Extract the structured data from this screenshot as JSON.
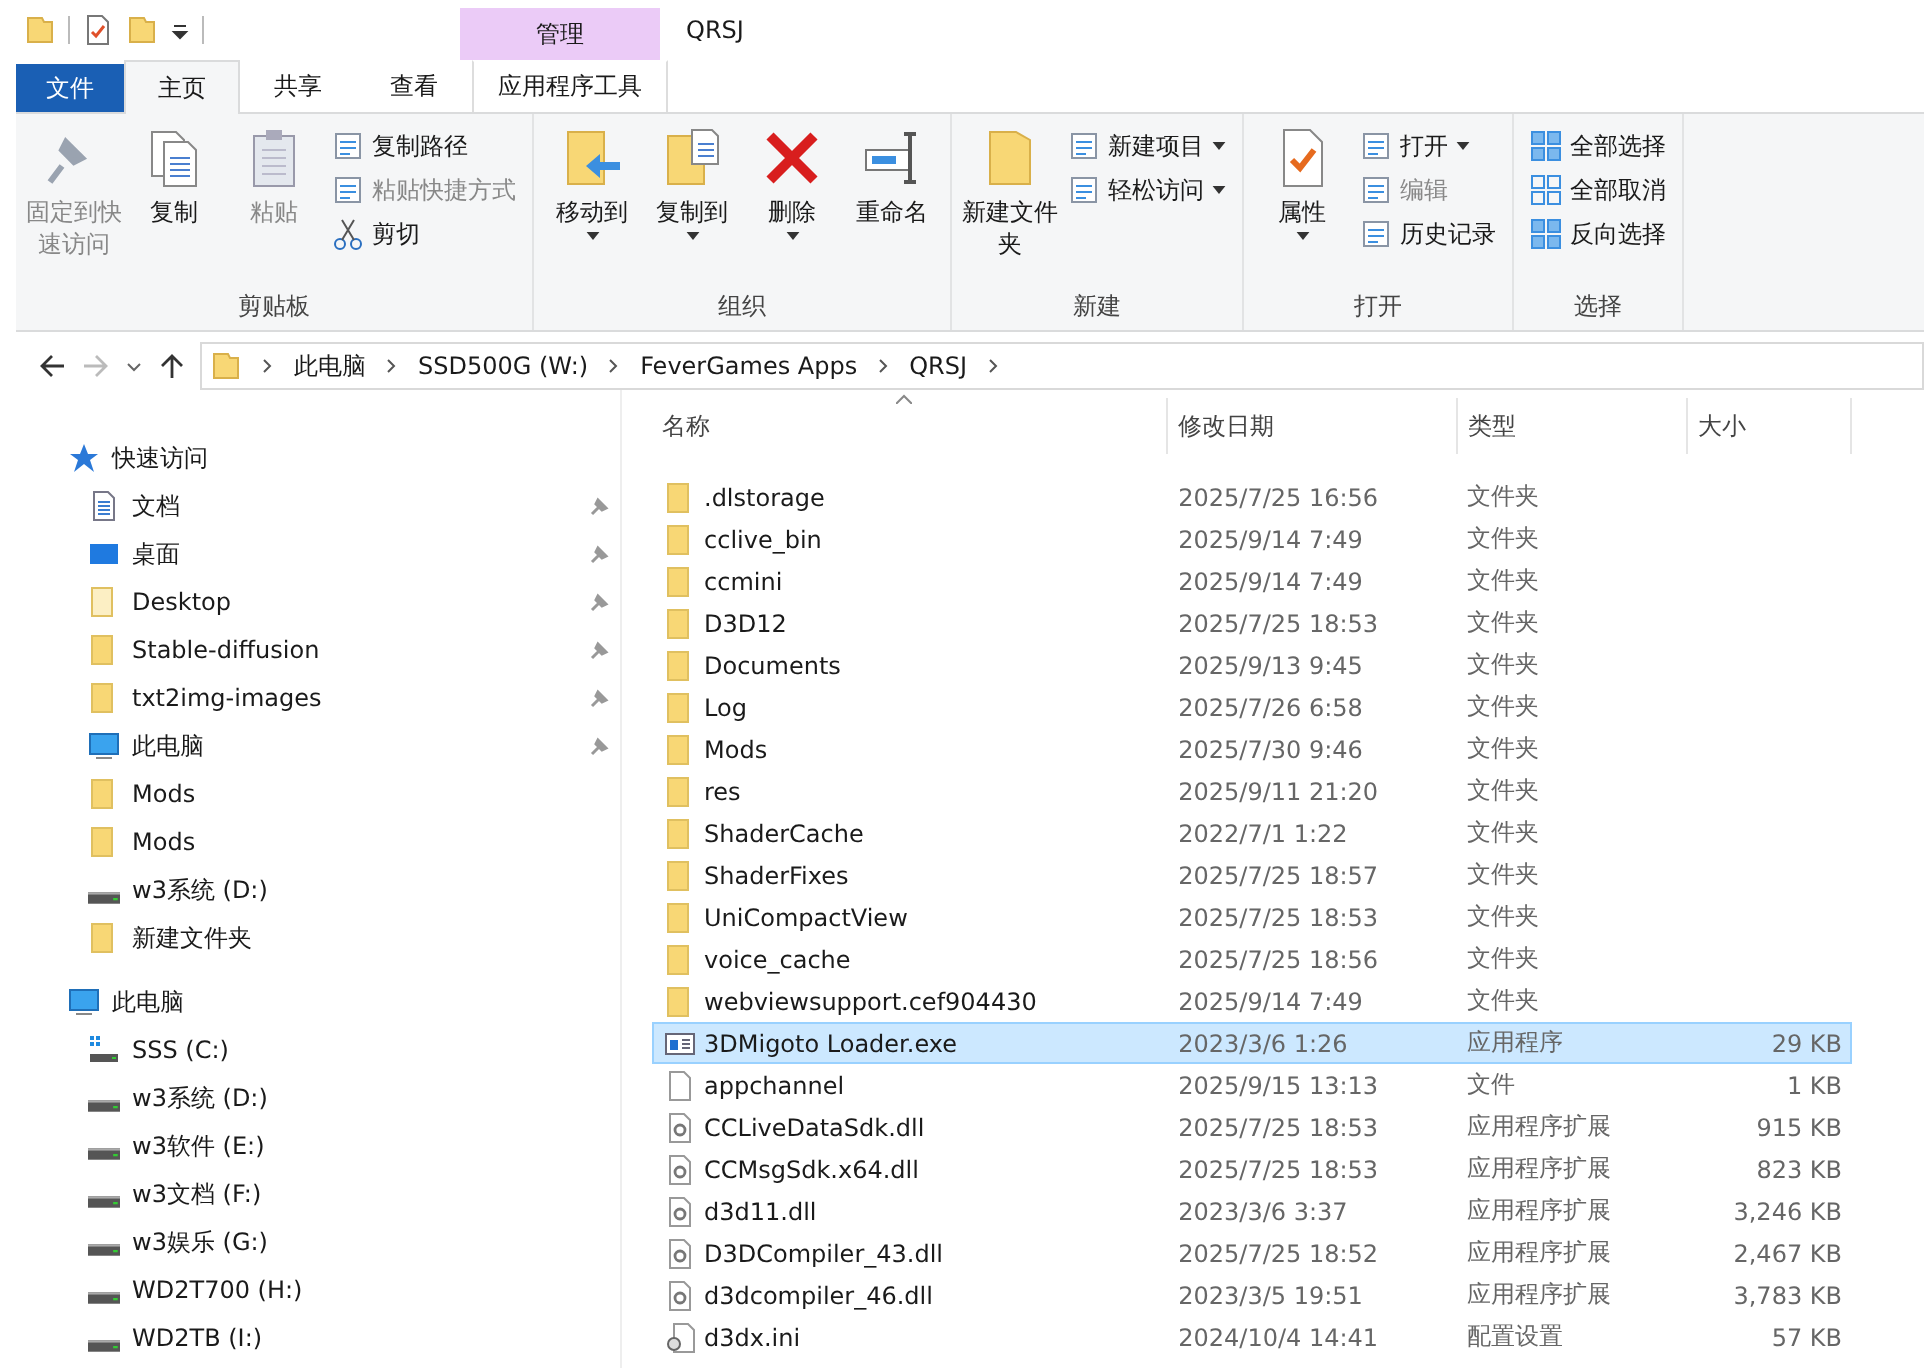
{
  "window": {
    "title": "QRSJ",
    "context_label": "管理"
  },
  "tabs": [
    {
      "label": "文件",
      "kind": "file",
      "selected": false
    },
    {
      "label": "主页",
      "kind": "normal",
      "selected": true
    },
    {
      "label": "共享",
      "kind": "normal",
      "selected": false
    },
    {
      "label": "查看",
      "kind": "normal",
      "selected": false
    },
    {
      "label": "应用程序工具",
      "kind": "context",
      "selected": false
    }
  ],
  "ribbon": {
    "groups": [
      {
        "label": "剪贴板",
        "items": [
          {
            "kind": "large",
            "label": "固定到快速访问",
            "disabled": true,
            "dropdown": false
          },
          {
            "kind": "large",
            "label": "复制",
            "disabled": false,
            "dropdown": false
          },
          {
            "kind": "large",
            "label": "粘贴",
            "disabled": true,
            "dropdown": false
          },
          {
            "kind": "small",
            "label": "复制路径",
            "disabled": false,
            "dropdown": false
          },
          {
            "kind": "small",
            "label": "粘贴快捷方式",
            "disabled": true,
            "dropdown": false
          },
          {
            "kind": "small",
            "label": "剪切",
            "disabled": false,
            "dropdown": false
          }
        ]
      },
      {
        "label": "组织",
        "items": [
          {
            "kind": "large",
            "label": "移动到",
            "disabled": false,
            "dropdown": true
          },
          {
            "kind": "large",
            "label": "复制到",
            "disabled": false,
            "dropdown": true
          },
          {
            "kind": "large",
            "label": "删除",
            "disabled": false,
            "dropdown": true
          },
          {
            "kind": "large",
            "label": "重命名",
            "disabled": false,
            "dropdown": false
          }
        ]
      },
      {
        "label": "新建",
        "items": [
          {
            "kind": "large",
            "label": "新建文件夹",
            "disabled": false,
            "dropdown": false
          },
          {
            "kind": "small",
            "label": "新建项目",
            "disabled": false,
            "dropdown": true
          },
          {
            "kind": "small",
            "label": "轻松访问",
            "disabled": false,
            "dropdown": true
          }
        ]
      },
      {
        "label": "打开",
        "items": [
          {
            "kind": "large",
            "label": "属性",
            "disabled": false,
            "dropdown": true
          },
          {
            "kind": "small",
            "label": "打开",
            "disabled": false,
            "dropdown": true
          },
          {
            "kind": "small",
            "label": "编辑",
            "disabled": true,
            "dropdown": false
          },
          {
            "kind": "small",
            "label": "历史记录",
            "disabled": false,
            "dropdown": false
          }
        ]
      },
      {
        "label": "选择",
        "items": [
          {
            "kind": "small",
            "label": "全部选择",
            "disabled": false,
            "dropdown": false
          },
          {
            "kind": "small",
            "label": "全部取消",
            "disabled": false,
            "dropdown": false
          },
          {
            "kind": "small",
            "label": "反向选择",
            "disabled": false,
            "dropdown": false
          }
        ]
      }
    ]
  },
  "address": {
    "back_disabled": false,
    "forward_disabled": true,
    "crumbs": [
      "此电脑",
      "SSD500G (W:)",
      "FeverGames Apps",
      "QRSJ"
    ]
  },
  "nav": [
    {
      "label": "快速访问",
      "kind": "star",
      "children": [
        {
          "label": "文档",
          "kind": "doc",
          "pinned": true
        },
        {
          "label": "桌面",
          "kind": "desktop",
          "pinned": true
        },
        {
          "label": "Desktop",
          "kind": "folder-light",
          "pinned": true
        },
        {
          "label": "Stable-diffusion",
          "kind": "folder",
          "pinned": true
        },
        {
          "label": "txt2img-images",
          "kind": "folder",
          "pinned": true
        },
        {
          "label": "此电脑",
          "kind": "pc",
          "pinned": true
        },
        {
          "label": "Mods",
          "kind": "folder",
          "pinned": false
        },
        {
          "label": "Mods",
          "kind": "folder",
          "pinned": false
        },
        {
          "label": "w3系统 (D:)",
          "kind": "drive",
          "pinned": false
        },
        {
          "label": "新建文件夹",
          "kind": "folder",
          "pinned": false
        }
      ]
    },
    {
      "label": "此电脑",
      "kind": "pc",
      "children": [
        {
          "label": "SSS (C:)",
          "kind": "os-drive",
          "pinned": false
        },
        {
          "label": "w3系统 (D:)",
          "kind": "drive",
          "pinned": false
        },
        {
          "label": "w3软件 (E:)",
          "kind": "drive",
          "pinned": false
        },
        {
          "label": "w3文档 (F:)",
          "kind": "drive",
          "pinned": false
        },
        {
          "label": "w3娱乐 (G:)",
          "kind": "drive",
          "pinned": false
        },
        {
          "label": "WD2T700 (H:)",
          "kind": "drive",
          "pinned": false
        },
        {
          "label": "WD2TB (I:)",
          "kind": "drive",
          "pinned": false
        }
      ]
    }
  ],
  "table": {
    "columns": [
      "名称",
      "修改日期",
      "类型",
      "大小"
    ],
    "rows": [
      {
        "name": ".dlstorage",
        "date": "2025/7/25 16:56",
        "type": "文件夹",
        "kind": "folder",
        "selected": false
      },
      {
        "name": "cclive_bin",
        "date": "2025/9/14 7:49",
        "type": "文件夹",
        "kind": "folder",
        "selected": false
      },
      {
        "name": "ccmini",
        "date": "2025/9/14 7:49",
        "type": "文件夹",
        "kind": "folder",
        "selected": false
      },
      {
        "name": "D3D12",
        "date": "2025/7/25 18:53",
        "type": "文件夹",
        "kind": "folder",
        "selected": false
      },
      {
        "name": "Documents",
        "date": "2025/9/13 9:45",
        "type": "文件夹",
        "kind": "folder",
        "selected": false
      },
      {
        "name": "Log",
        "date": "2025/7/26 6:58",
        "type": "文件夹",
        "kind": "folder",
        "selected": false
      },
      {
        "name": "Mods",
        "date": "2025/7/30 9:46",
        "type": "文件夹",
        "kind": "folder",
        "selected": false
      },
      {
        "name": "res",
        "date": "2025/9/11 21:20",
        "type": "文件夹",
        "kind": "folder",
        "selected": false
      },
      {
        "name": "ShaderCache",
        "date": "2022/7/1 1:22",
        "type": "文件夹",
        "kind": "folder",
        "selected": false
      },
      {
        "name": "ShaderFixes",
        "date": "2025/7/25 18:57",
        "type": "文件夹",
        "kind": "folder",
        "selected": false
      },
      {
        "name": "UniCompactView",
        "date": "2025/7/25 18:53",
        "type": "文件夹",
        "kind": "folder",
        "selected": false
      },
      {
        "name": "voice_cache",
        "date": "2025/7/25 18:56",
        "type": "文件夹",
        "kind": "folder",
        "selected": false
      },
      {
        "name": "webviewsupport.cef904430",
        "date": "2025/9/14 7:49",
        "type": "文件夹",
        "kind": "folder",
        "selected": false
      },
      {
        "name": "3DMigoto Loader.exe",
        "date": "2023/3/6 1:26",
        "type": "应用程序",
        "size": "29 KB",
        "kind": "exe",
        "selected": true
      },
      {
        "name": "appchannel",
        "date": "2025/9/15 13:13",
        "type": "文件",
        "size": "1 KB",
        "kind": "file",
        "selected": false
      },
      {
        "name": "CCLiveDataSdk.dll",
        "date": "2025/7/25 18:53",
        "type": "应用程序扩展",
        "size": "915 KB",
        "kind": "dll",
        "selected": false
      },
      {
        "name": "CCMsgSdk.x64.dll",
        "date": "2025/7/25 18:53",
        "type": "应用程序扩展",
        "size": "823 KB",
        "kind": "dll",
        "selected": false
      },
      {
        "name": "d3d11.dll",
        "date": "2023/3/6 3:37",
        "type": "应用程序扩展",
        "size": "3,246 KB",
        "kind": "dll",
        "selected": false
      },
      {
        "name": "D3DCompiler_43.dll",
        "date": "2025/7/25 18:52",
        "type": "应用程序扩展",
        "size": "2,467 KB",
        "kind": "dll",
        "selected": false
      },
      {
        "name": "d3dcompiler_46.dll",
        "date": "2023/3/5 19:51",
        "type": "应用程序扩展",
        "size": "3,783 KB",
        "kind": "dll",
        "selected": false
      },
      {
        "name": "d3dx.ini",
        "date": "2024/10/4 14:41",
        "type": "配置设置",
        "size": "57 KB",
        "kind": "ini",
        "selected": false
      }
    ]
  }
}
